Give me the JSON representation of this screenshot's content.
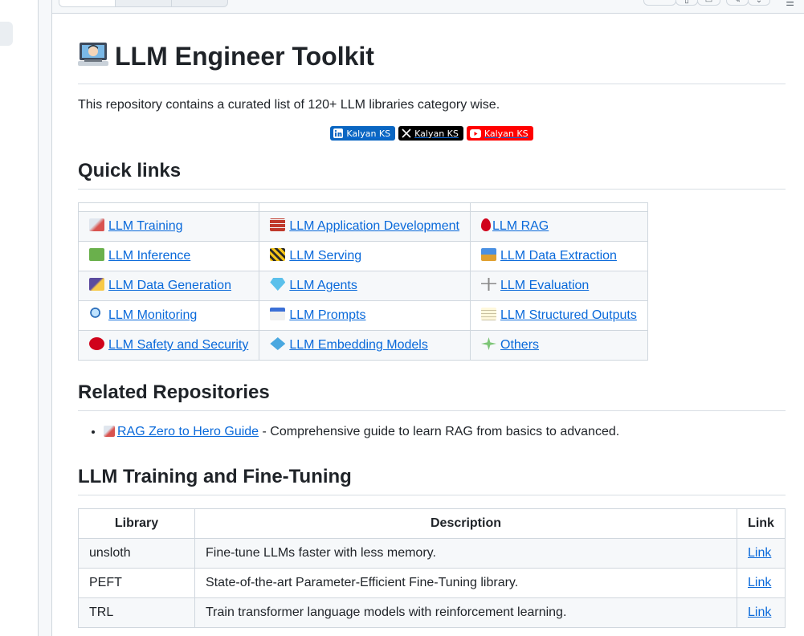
{
  "title": "LLM Engineer Toolkit",
  "intro": "This repository contains a curated list of 120+ LLM libraries category wise.",
  "badges": [
    {
      "platform": "linkedin-icon",
      "label": "Kalyan KS",
      "color": "#0a66c2"
    },
    {
      "platform": "x-icon",
      "label": "Kalyan KS",
      "color": "#000000"
    },
    {
      "platform": "youtube-icon",
      "label": "Kalyan KS",
      "color": "#ff0000"
    }
  ],
  "quick_links": {
    "heading": "Quick links",
    "rows": [
      [
        {
          "icon": "rocket-icon",
          "label": "LLM Training"
        },
        {
          "icon": "bricks-icon",
          "label": "LLM Application Development"
        },
        {
          "icon": "drop-of-blood-icon",
          "label": "LLM RAG"
        }
      ],
      [
        {
          "icon": "green-square-icon",
          "label": "LLM Inference"
        },
        {
          "icon": "construction-icon",
          "label": "LLM Serving"
        },
        {
          "icon": "outbox-tray-icon",
          "label": "LLM Data Extraction"
        }
      ],
      [
        {
          "icon": "shooting-star-icon",
          "label": "LLM Data Generation"
        },
        {
          "icon": "gem-icon",
          "label": "LLM Agents"
        },
        {
          "icon": "balance-scale-icon",
          "label": "LLM Evaluation"
        }
      ],
      [
        {
          "icon": "magnifier-icon",
          "label": "LLM Monitoring"
        },
        {
          "icon": "calendar-icon",
          "label": "LLM Prompts"
        },
        {
          "icon": "memo-icon",
          "label": "LLM Structured Outputs"
        }
      ],
      [
        {
          "icon": "stop-sign-icon",
          "label": "LLM Safety and Security"
        },
        {
          "icon": "diamond-dot-icon",
          "label": "LLM Embedding Models"
        },
        {
          "icon": "sparkle-icon",
          "label": "Others"
        }
      ]
    ]
  },
  "related": {
    "heading": "Related Repositories",
    "items": [
      {
        "icon": "rocket-icon",
        "link": "RAG Zero to Hero Guide",
        "text": " - Comprehensive guide to learn RAG from basics to advanced."
      }
    ]
  },
  "training": {
    "heading": "LLM Training and Fine-Tuning",
    "columns": [
      "Library",
      "Description",
      "Link"
    ],
    "rows": [
      {
        "library": "unsloth",
        "description": "Fine-tune LLMs faster with less memory.",
        "link": "Link"
      },
      {
        "library": "PEFT",
        "description": "State-of-the-art Parameter-Efficient Fine-Tuning library.",
        "link": "Link"
      },
      {
        "library": "TRL",
        "description": "Train transformer language models with reinforcement learning.",
        "link": "Link"
      }
    ]
  }
}
